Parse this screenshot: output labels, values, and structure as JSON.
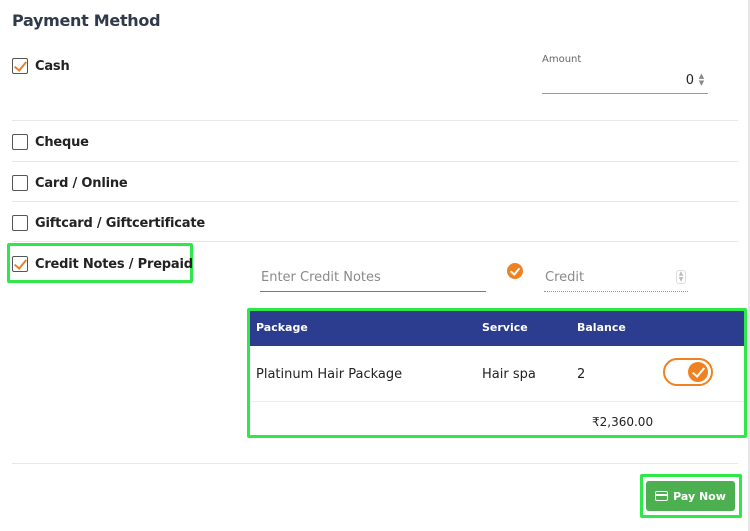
{
  "title": "Payment Method",
  "methods": [
    {
      "label": "Cash",
      "checked": true
    },
    {
      "label": "Cheque",
      "checked": false
    },
    {
      "label": "Card / Online",
      "checked": false
    },
    {
      "label": "Giftcard / Giftcertificate",
      "checked": false
    },
    {
      "label": "Credit Notes / Prepaid",
      "checked": true
    }
  ],
  "amount": {
    "label": "Amount",
    "value": "0"
  },
  "credit_notes": {
    "placeholder": "Enter Credit Notes",
    "credit_placeholder": "Credit"
  },
  "table": {
    "headers": {
      "package": "Package",
      "service": "Service",
      "balance": "Balance"
    },
    "rows": [
      {
        "package": "Platinum Hair Package",
        "service": "Hair spa",
        "balance": "2",
        "selected": true
      }
    ],
    "total": "₹2,360.00"
  },
  "pay_button": {
    "label": "Pay Now"
  },
  "colors": {
    "accent": "#ef8120",
    "header": "#2c3d8f",
    "pay": "#4caf50",
    "highlight": "#2ee84a"
  },
  "icons": {
    "credit_ok": "check-circle-icon",
    "pay": "credit-card-icon"
  }
}
